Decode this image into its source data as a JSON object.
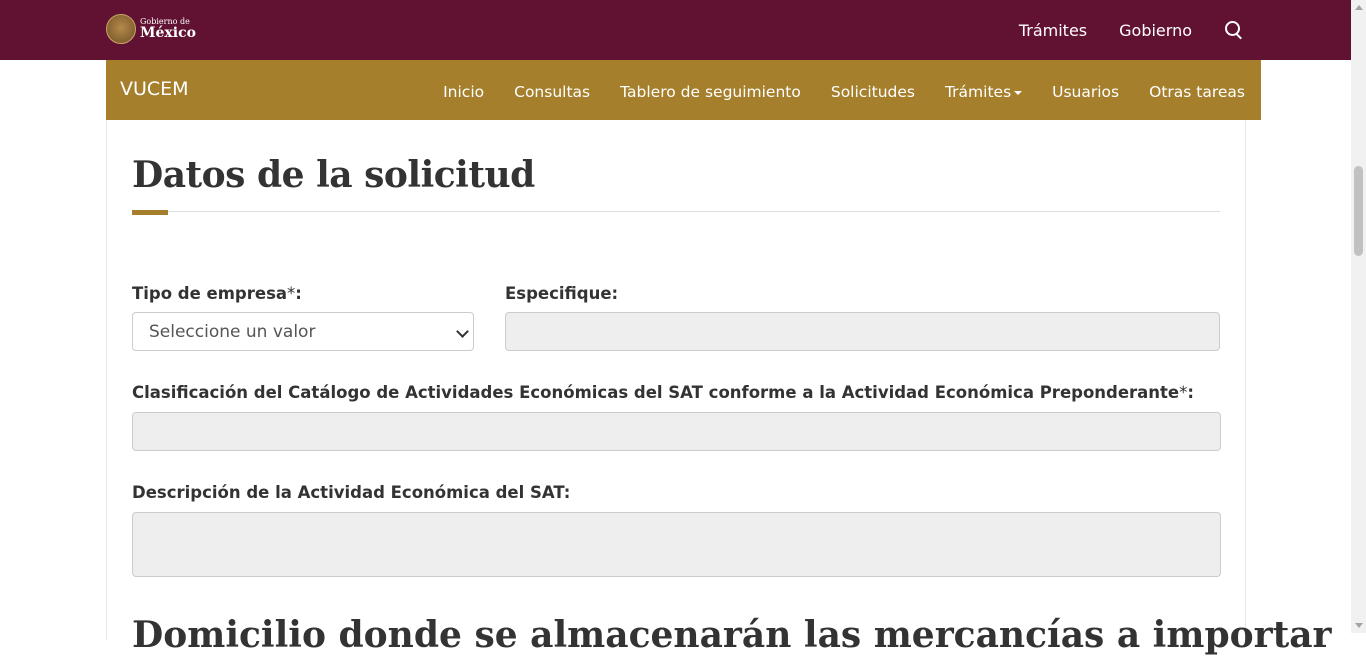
{
  "gov_header": {
    "logo_small": "Gobierno de",
    "logo_big": "México",
    "nav": [
      "Trámites",
      "Gobierno"
    ],
    "search_icon": "search-icon"
  },
  "app_header": {
    "brand": "VUCEM",
    "nav": [
      "Inicio",
      "Consultas",
      "Tablero de seguimiento",
      "Solicitudes",
      "Trámites",
      "Usuarios",
      "Otras tareas"
    ]
  },
  "main": {
    "title": "Datos de la solicitud",
    "fields": {
      "tipo_empresa": {
        "label": "Tipo de empresa",
        "required": "*",
        "colon": ":",
        "value": "Seleccione un valor"
      },
      "especifique": {
        "label": "Especifique:",
        "value": ""
      },
      "clasificacion": {
        "label": "Clasificación del Catálogo de Actividades Económicas del SAT conforme a la Actividad Económica Preponderante",
        "required": "*",
        "colon": ":",
        "value": ""
      },
      "descripcion": {
        "label": "Descripción de la Actividad Económica del SAT:",
        "value": ""
      }
    },
    "next_section_title": "Domicilio donde se almacenarán las mercancías a importar"
  },
  "colors": {
    "gov_bar": "#611232",
    "app_bar": "#a57f2c",
    "disabled_field": "#eeeeee"
  }
}
